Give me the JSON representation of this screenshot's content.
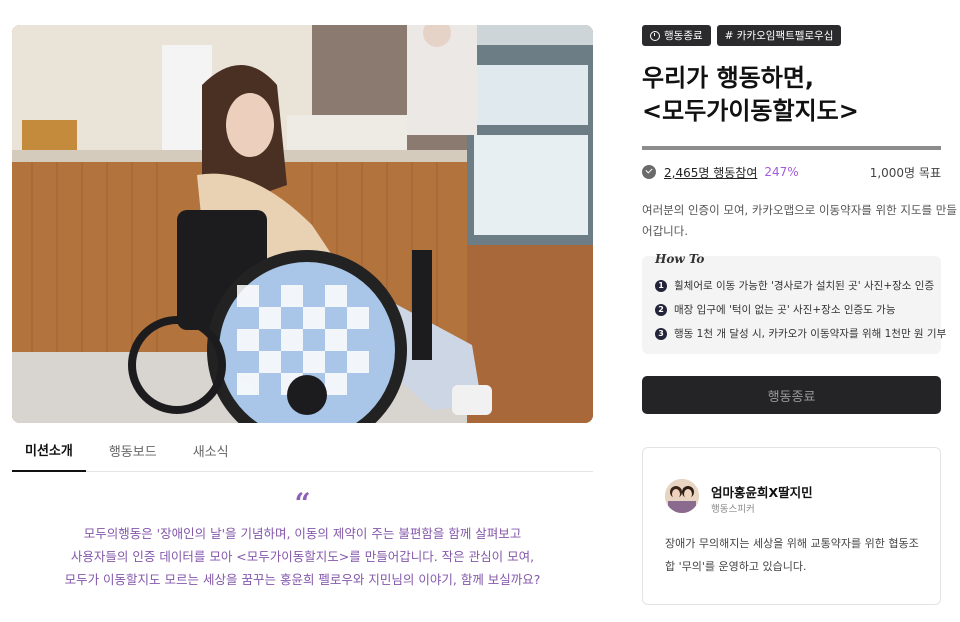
{
  "hero": {
    "image_description_icon": "campaign-photo"
  },
  "tabs": [
    {
      "label": "미션소개",
      "active": true
    },
    {
      "label": "행동보드",
      "active": false
    },
    {
      "label": "새소식",
      "active": false
    }
  ],
  "quote": {
    "mark": "“",
    "lines": [
      "모두의행동은 '장애인의 날'을 기념하며, 이동의 제약이 주는 불편함을 함께 살펴보고",
      "사용자들의 인증 데이터를 모아 <모두가이동할지도>를 만들어갑니다. 작은 관심이 모여,",
      "모두가 이동할지도 모르는 세상을 꿈꾸는 홍윤희 펠로우와 지민님의 이야기, 함께 보실까요?"
    ]
  },
  "badges": {
    "status": "행동종료",
    "status_icon": "clock-icon",
    "tag": "# 카카오임팩트펠로우십"
  },
  "title": {
    "line1": "우리가 행동하면,",
    "line2": "<모두가이동할지도>"
  },
  "progress": {
    "fill_fraction": 1.0
  },
  "stats": {
    "participants": "2,465명 행동참여",
    "percent": "247%",
    "goal": "1,000명 목표"
  },
  "description": {
    "line1": "여러분의 인증이 모여, 카카오맵으로 이동약자를 위한 지도를 만들",
    "line2": "어갑니다."
  },
  "howto": {
    "title": "How To",
    "items": [
      {
        "num": "1",
        "text": "휠체어로 이동 가능한 '경사로가 설치된 곳' 사진+장소 인증"
      },
      {
        "num": "2",
        "text": "매장 입구에 '턱이 없는 곳' 사진+장소 인증도 가능"
      },
      {
        "num": "3",
        "text": "행동 1천 개 달성 시, 카카오가 이동약자를 위해 1천만 원 기부"
      }
    ]
  },
  "action_button": {
    "label": "행동종료"
  },
  "speaker": {
    "name": "엄마홍윤희X딸지민",
    "role": "행동스피커",
    "desc_line1": "장애가 무의해지는 세상을 위해 교통약자를 위한 협동조",
    "desc_line2": "합 '무의'를 운영하고 있습니다."
  },
  "colors": {
    "accent_purple": "#8458ab",
    "percent_purple": "#a35ddc",
    "dark": "#242427"
  }
}
